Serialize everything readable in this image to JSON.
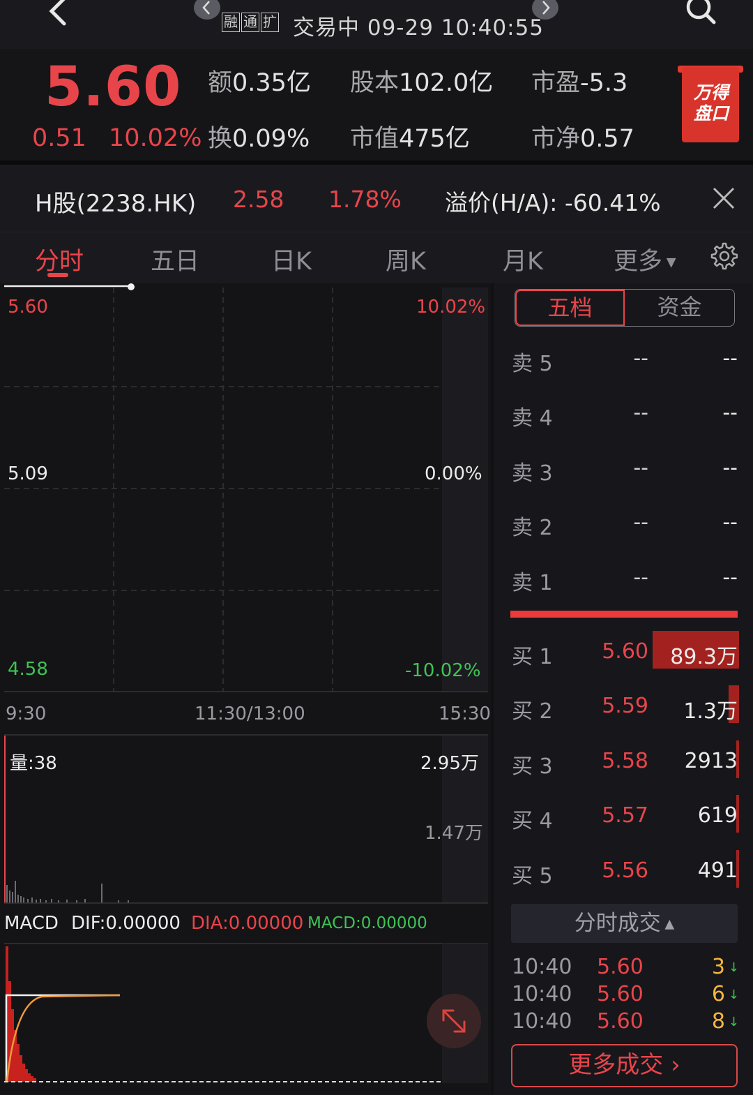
{
  "topbar": {
    "badges": [
      "融",
      "通",
      "扩"
    ],
    "status": "交易中 09-29 10:40:55"
  },
  "quote": {
    "price": "5.60",
    "change": "0.51",
    "change_pct": "10.02%",
    "stats": [
      {
        "label": "额",
        "value": "0.35亿"
      },
      {
        "label": "股本",
        "value": "102.0亿"
      },
      {
        "label": "市盈",
        "value": "-5.3"
      },
      {
        "label": "换",
        "value": "0.09%"
      },
      {
        "label": "市值",
        "value": "475亿"
      },
      {
        "label": "市净",
        "value": "0.57"
      }
    ],
    "wind_badge": [
      "万得",
      "盘口"
    ]
  },
  "hshare": {
    "name": "H股(2238.HK)",
    "price": "2.58",
    "pct": "1.78%",
    "premium": "溢价(H/A): -60.41%"
  },
  "tabs": [
    "分时",
    "五日",
    "日K",
    "周K",
    "月K",
    "更多"
  ],
  "chart": {
    "price_labels": {
      "top": "5.60",
      "mid": "5.09",
      "bottom": "4.58"
    },
    "pct_labels": {
      "top": "10.02%",
      "mid": "0.00%",
      "bottom": "-10.02%"
    },
    "time_labels": [
      "9:30",
      "11:30/13:00",
      "15:30"
    ],
    "volume_label": "量:38",
    "volume_ticks": [
      "2.95万",
      "1.47万"
    ],
    "macd": {
      "name": "MACD",
      "dif": "DIF:0.00000",
      "dia": "DIA:0.00000",
      "macd": "MACD:0.00000"
    }
  },
  "orderbook": {
    "tabs": [
      "五档",
      "资金"
    ],
    "asks": [
      {
        "label": "卖 5",
        "price": "--",
        "vol": "--"
      },
      {
        "label": "卖 4",
        "price": "--",
        "vol": "--"
      },
      {
        "label": "卖 3",
        "price": "--",
        "vol": "--"
      },
      {
        "label": "卖 2",
        "price": "--",
        "vol": "--"
      },
      {
        "label": "卖 1",
        "price": "--",
        "vol": "--"
      }
    ],
    "bids": [
      {
        "label": "买 1",
        "price": "5.60",
        "vol": "89.3万",
        "bar": 1.0
      },
      {
        "label": "买 2",
        "price": "5.59",
        "vol": "1.3万",
        "bar": 0.12
      },
      {
        "label": "买 3",
        "price": "5.58",
        "vol": "2913",
        "bar": 0.03
      },
      {
        "label": "买 4",
        "price": "5.57",
        "vol": "619",
        "bar": 0.02
      },
      {
        "label": "买 5",
        "price": "5.56",
        "vol": "491",
        "bar": 0.02
      }
    ]
  },
  "ticks": {
    "header": "分时成交",
    "rows": [
      {
        "time": "10:40",
        "price": "5.60",
        "vol": "3"
      },
      {
        "time": "10:40",
        "price": "5.60",
        "vol": "6"
      },
      {
        "time": "10:40",
        "price": "5.60",
        "vol": "8"
      }
    ],
    "more": "更多成交"
  }
}
